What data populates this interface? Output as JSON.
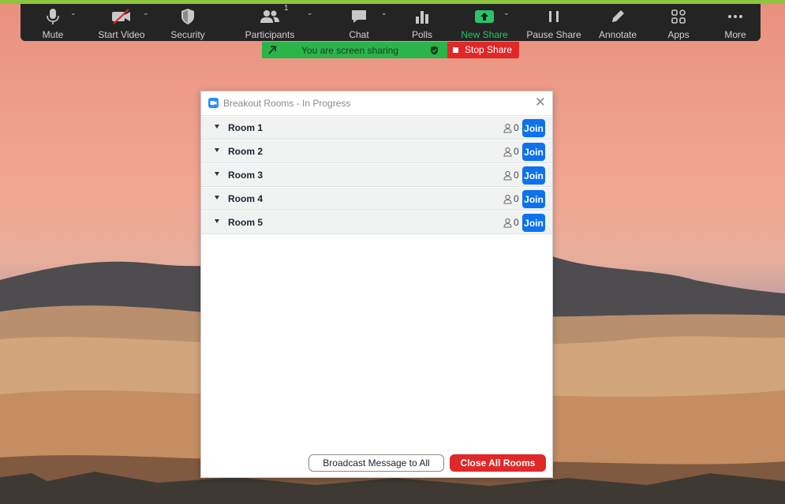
{
  "colors": {
    "accent_green": "#27c46b",
    "brand_blue": "#0e72ed",
    "danger_red": "#e02828",
    "toolbar_bg": "#242424"
  },
  "toolbar": {
    "mute": "Mute",
    "start_video": "Start Video",
    "security": "Security",
    "participants": "Participants",
    "participants_count": "1",
    "chat": "Chat",
    "polls": "Polls",
    "new_share": "New Share",
    "pause_share": "Pause Share",
    "annotate": "Annotate",
    "apps": "Apps",
    "more": "More"
  },
  "share_banner": {
    "status": "You are screen sharing",
    "stop_label": "Stop Share"
  },
  "breakout_dialog": {
    "title": "Breakout Rooms - In Progress",
    "rooms": [
      {
        "name": "Room 1",
        "count": "0",
        "join_label": "Join"
      },
      {
        "name": "Room 2",
        "count": "0",
        "join_label": "Join"
      },
      {
        "name": "Room 3",
        "count": "0",
        "join_label": "Join"
      },
      {
        "name": "Room 4",
        "count": "0",
        "join_label": "Join"
      },
      {
        "name": "Room 5",
        "count": "0",
        "join_label": "Join"
      }
    ],
    "broadcast_label": "Broadcast Message to All",
    "close_all_label": "Close All Rooms"
  }
}
